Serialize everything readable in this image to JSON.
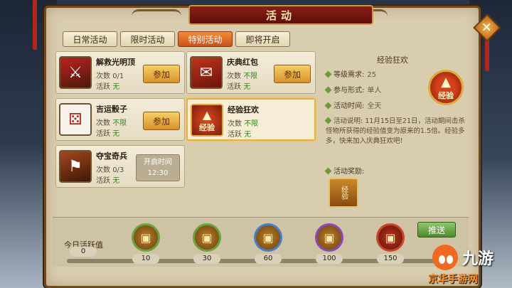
{
  "window": {
    "title": "活动"
  },
  "tabs": [
    {
      "label": "日常活动",
      "active": false
    },
    {
      "label": "限时活动",
      "active": false
    },
    {
      "label": "特别活动",
      "active": true
    },
    {
      "label": "即将开启",
      "active": false
    }
  ],
  "activities": [
    {
      "name": "解救光明顶",
      "count_label": "次数",
      "count_value": "0/1",
      "active_label": "活跃",
      "active_value": "无",
      "button": "参加",
      "icon": "warrior-icon"
    },
    {
      "name": "庆典红包",
      "count_label": "次数",
      "count_value": "不限",
      "active_label": "活跃",
      "active_value": "无",
      "button": "参加",
      "icon": "red-envelope-icon"
    },
    {
      "name": "吉运骰子",
      "count_label": "次数",
      "count_value": "不限",
      "active_label": "活跃",
      "active_value": "无",
      "button": "参加",
      "icon": "dice-icon"
    },
    {
      "name": "经验狂欢",
      "count_label": "次数",
      "count_value": "不限",
      "active_label": "活跃",
      "active_value": "无",
      "icon": "exp-icon",
      "icon_text": "经验",
      "selected": true
    },
    {
      "name": "夺宝奇兵",
      "count_label": "次数",
      "count_value": "0/3",
      "active_label": "活跃",
      "active_value": "无",
      "open_label": "开启时间",
      "open_time": "12:30",
      "icon": "treasure-soldier-icon"
    }
  ],
  "detail": {
    "title": "经验狂欢",
    "level_label": "等级需求:",
    "level_value": "25",
    "form_label": "参与形式:",
    "form_value": "单人",
    "time_label": "活动时间:",
    "time_value": "全天",
    "desc_label": "活动说明:",
    "desc_text": "11月15日至21日，活动期间击杀怪物所获得的经验值变为原来的1.5倍。经验多多，快来加入庆典狂欢吧!",
    "reward_label": "活动奖励:",
    "icon_text": "经验",
    "reward_icon_text": "经验"
  },
  "activeness": {
    "label": "今日活跃值",
    "current": "0",
    "progress": 0,
    "milestones": [
      "10",
      "30",
      "60",
      "100",
      "150"
    ],
    "push_button": "推送"
  },
  "watermark": {
    "text": "九游",
    "sub": "京华手游网"
  },
  "colors": {
    "accent": "#e07428",
    "frame": "#6e4a22",
    "green": "#2e8b1f"
  }
}
